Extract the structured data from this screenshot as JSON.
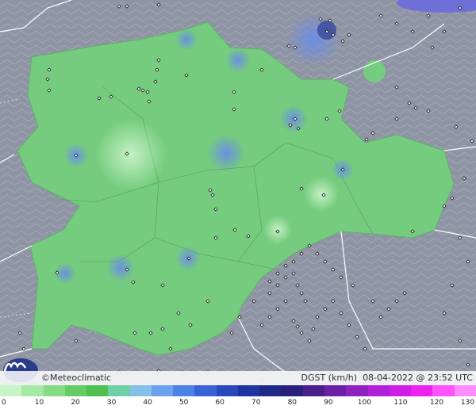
{
  "brand": "©Meteoclimatic",
  "caption": {
    "variable": "DGST (km/h)",
    "datetime": "08-04-2022 @ 23:52 UTC"
  },
  "legend": {
    "colors": [
      "#c8f5c8",
      "#a6e9a6",
      "#86dc86",
      "#64cc64",
      "#4fbf4f",
      "#6fd0a8",
      "#86bfe8",
      "#6aa2ec",
      "#4c82e6",
      "#3a62d8",
      "#2a48be",
      "#1f34a0",
      "#1e2a86",
      "#2a1f7a",
      "#4a1f8c",
      "#6c20a6",
      "#8e22c0",
      "#b020d8",
      "#d01ee6",
      "#ee22ee",
      "#ff52ff",
      "#ff8cff"
    ],
    "ticks": [
      "0",
      "10",
      "20",
      "30",
      "40",
      "50",
      "60",
      "70",
      "80",
      "90",
      "100",
      "110",
      "120",
      "130"
    ]
  },
  "colors": {
    "background": "#8e93a3",
    "region_fill": "#76cc7e",
    "gust_high": "#6f8ee8",
    "station": "#1a1a1a",
    "border": "#ffffff"
  }
}
